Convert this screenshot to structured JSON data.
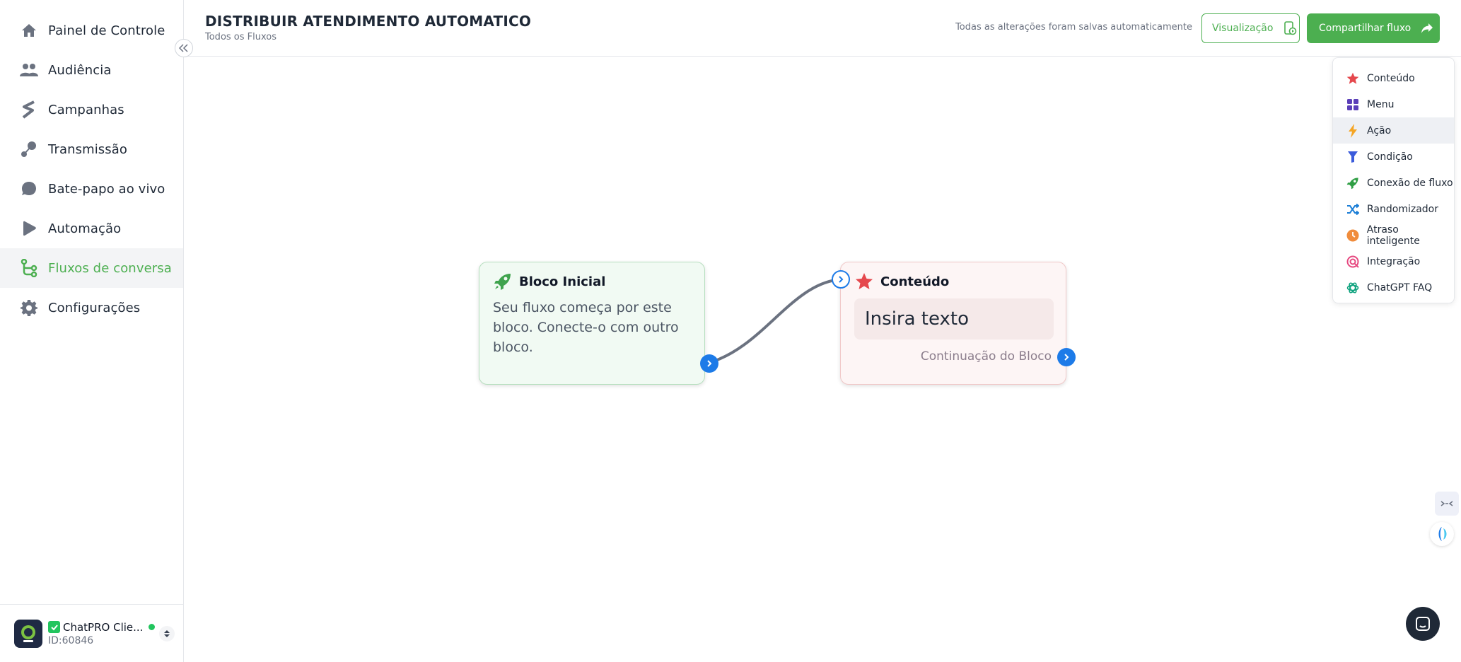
{
  "sidebar": {
    "items": [
      {
        "label": "Painel de Controle",
        "icon": "home-icon"
      },
      {
        "label": "Audiência",
        "icon": "users-icon"
      },
      {
        "label": "Campanhas",
        "icon": "campaign-icon"
      },
      {
        "label": "Transmissão",
        "icon": "broadcast-icon"
      },
      {
        "label": "Bate-papo ao vivo",
        "icon": "chat-bubble-icon"
      },
      {
        "label": "Automação",
        "icon": "automation-icon"
      },
      {
        "label": "Fluxos de conversa",
        "icon": "flow-icon"
      },
      {
        "label": "Configurações",
        "icon": "gear-icon"
      }
    ],
    "active_item": "Fluxos de conversa",
    "account": {
      "name": "ChatPRO Clie...",
      "id": "ID:60846"
    }
  },
  "header": {
    "title": "DISTRIBUIR ATENDIMENTO AUTOMATICO",
    "breadcrumb": "Todos os Fluxos",
    "saved_status": "Todas as alterações foram salvas automaticamente",
    "preview_label": "Visualização",
    "share_label": "Compartilhar fluxo"
  },
  "canvas": {
    "start_block": {
      "title": "Bloco Inicial",
      "description": "Seu fluxo começa por este bloco. Conecte-o com outro bloco."
    },
    "content_block": {
      "title": "Conteúdo",
      "text_placeholder": "Insira texto",
      "continuation_label": "Continuação do Bloco"
    }
  },
  "palette": {
    "items": [
      {
        "label": "Conteúdo",
        "icon": "star-icon",
        "color": "#e5484d"
      },
      {
        "label": "Menu",
        "icon": "grid-icon",
        "color": "#5b3fb8"
      },
      {
        "label": "Ação",
        "icon": "lightning-icon",
        "color": "#f5a524"
      },
      {
        "label": "Condição",
        "icon": "filter-icon",
        "color": "#3b5bdb"
      },
      {
        "label": "Conexão de fluxo",
        "icon": "rocket-icon",
        "color": "#2f9e44"
      },
      {
        "label": "Randomizador",
        "icon": "shuffle-icon",
        "color": "#1c7ed6"
      },
      {
        "label": "Atraso inteligente",
        "icon": "clock-icon",
        "color": "#f08c3c"
      },
      {
        "label": "Integração",
        "icon": "integration-icon",
        "color": "#e64980"
      },
      {
        "label": "ChatGPT FAQ",
        "icon": "openai-icon",
        "color": "#10a37f"
      }
    ],
    "highlighted": "Ação"
  },
  "colors": {
    "brand_green": "#4caf50",
    "port_blue": "#1d7be8"
  }
}
